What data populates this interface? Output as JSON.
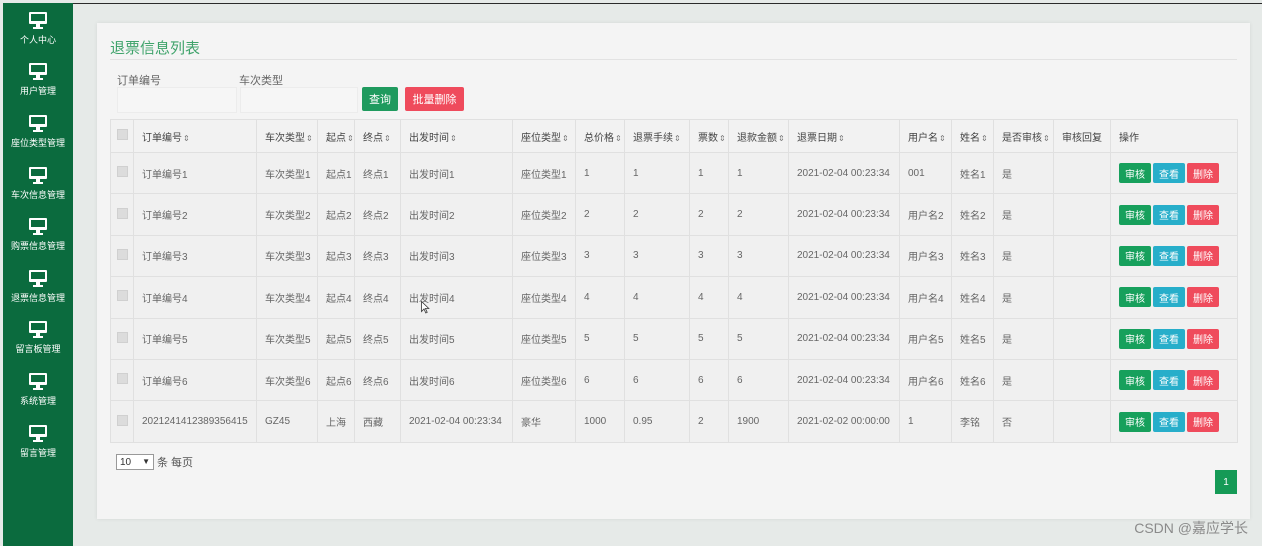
{
  "sidebar": {
    "items": [
      {
        "label": "个人中心",
        "icon": "monitor-icon"
      },
      {
        "label": "用户管理",
        "icon": "monitor-icon"
      },
      {
        "label": "座位类型管理",
        "icon": "monitor-icon"
      },
      {
        "label": "车次信息管理",
        "icon": "monitor-icon"
      },
      {
        "label": "购票信息管理",
        "icon": "monitor-icon"
      },
      {
        "label": "退票信息管理",
        "icon": "monitor-icon"
      },
      {
        "label": "留言板管理",
        "icon": "monitor-icon"
      },
      {
        "label": "系统管理",
        "icon": "monitor-icon"
      },
      {
        "label": "留言管理",
        "icon": "monitor-icon"
      }
    ]
  },
  "page": {
    "title": "退票信息列表"
  },
  "search": {
    "order_label": "订单编号",
    "train_type_label": "车次类型",
    "order_value": "",
    "train_type_value": "",
    "query_button": "查询",
    "batch_delete_button": "批量删除"
  },
  "table": {
    "headers": [
      {
        "label": "订单编号",
        "sortable": true
      },
      {
        "label": "车次类型",
        "sortable": true
      },
      {
        "label": "起点",
        "sortable": true
      },
      {
        "label": "终点",
        "sortable": true
      },
      {
        "label": "出发时间",
        "sortable": true
      },
      {
        "label": "座位类型",
        "sortable": true
      },
      {
        "label": "总价格",
        "sortable": true
      },
      {
        "label": "退票手续",
        "sortable": true
      },
      {
        "label": "票数",
        "sortable": true
      },
      {
        "label": "退款金额",
        "sortable": true
      },
      {
        "label": "退票日期",
        "sortable": true
      },
      {
        "label": "用户名",
        "sortable": true
      },
      {
        "label": "姓名",
        "sortable": true
      },
      {
        "label": "是否审核",
        "sortable": true
      },
      {
        "label": "审核回复",
        "sortable": false
      },
      {
        "label": "操作",
        "sortable": false
      }
    ],
    "sort_glyph": "⇕",
    "rows": [
      [
        "订单编号1",
        "车次类型1",
        "起点1",
        "终点1",
        "出发时间1",
        "座位类型1",
        "1",
        "1",
        "1",
        "1",
        "2021-02-04 00:23:34",
        "001",
        "姓名1",
        "是",
        ""
      ],
      [
        "订单编号2",
        "车次类型2",
        "起点2",
        "终点2",
        "出发时间2",
        "座位类型2",
        "2",
        "2",
        "2",
        "2",
        "2021-02-04 00:23:34",
        "用户名2",
        "姓名2",
        "是",
        ""
      ],
      [
        "订单编号3",
        "车次类型3",
        "起点3",
        "终点3",
        "出发时间3",
        "座位类型3",
        "3",
        "3",
        "3",
        "3",
        "2021-02-04 00:23:34",
        "用户名3",
        "姓名3",
        "是",
        ""
      ],
      [
        "订单编号4",
        "车次类型4",
        "起点4",
        "终点4",
        "出发时间4",
        "座位类型4",
        "4",
        "4",
        "4",
        "4",
        "2021-02-04 00:23:34",
        "用户名4",
        "姓名4",
        "是",
        ""
      ],
      [
        "订单编号5",
        "车次类型5",
        "起点5",
        "终点5",
        "出发时间5",
        "座位类型5",
        "5",
        "5",
        "5",
        "5",
        "2021-02-04 00:23:34",
        "用户名5",
        "姓名5",
        "是",
        ""
      ],
      [
        "订单编号6",
        "车次类型6",
        "起点6",
        "终点6",
        "出发时间6",
        "座位类型6",
        "6",
        "6",
        "6",
        "6",
        "2021-02-04 00:23:34",
        "用户名6",
        "姓名6",
        "是",
        ""
      ],
      [
        "2021241412389356415",
        "GZ45",
        "上海",
        "西藏",
        "2021-02-04 00:23:34",
        "豪华",
        "1000",
        "0.95",
        "2",
        "1900",
        "2021-02-02 00:00:00",
        "1",
        "李铭",
        "否",
        ""
      ]
    ],
    "actions": {
      "review": "审核",
      "view": "查看",
      "delete": "删除"
    }
  },
  "pagination": {
    "page_size": "10",
    "per_page_label": "条 每页",
    "current_page": "1"
  },
  "watermark": "CSDN @嘉应学长",
  "colors": {
    "sidebar": "#0b6b3e",
    "title": "#3fa36b",
    "query": "#1f9a5e",
    "batch_delete": "#ef4b5c",
    "review": "#17a05c",
    "view": "#27aeca",
    "delete": "#ef4b5c",
    "page_active": "#159a56"
  }
}
